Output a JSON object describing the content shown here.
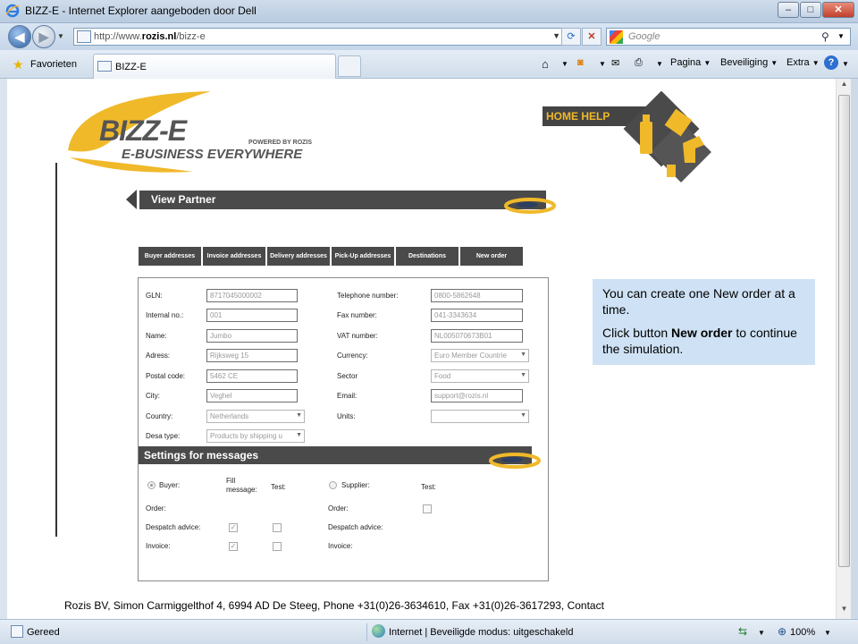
{
  "window": {
    "title": "BIZZ-E - Internet Explorer aangeboden door Dell",
    "min": "–",
    "max": "□",
    "close": "✕"
  },
  "nav": {
    "back": "◀",
    "forward": "▶",
    "url_prefix": "http://www.",
    "url_domain": "rozis.nl",
    "url_path": "/bizz-e",
    "search_placeholder": "Google"
  },
  "favbar": {
    "favorites_label": "Favorieten",
    "tab_label": "BIZZ-E",
    "commands": [
      "Pagina",
      "Beveiliging",
      "Extra"
    ]
  },
  "page": {
    "logo_brand": "BIZZ-E",
    "logo_tagline": "E-BUSINESS EVERYWHERE",
    "logo_powered": "POWERED BY ROZIS",
    "home_help": "HOME HELP",
    "section_title": "View Partner",
    "tabs": [
      "Buyer addresses",
      "Invoice addresses",
      "Delivery addresses",
      "Pick-Up addresses",
      "Destinations",
      "New order"
    ],
    "left_fields": [
      {
        "label": "GLN:",
        "value": "8717045000002",
        "kind": "input"
      },
      {
        "label": "Internal no.:",
        "value": "001",
        "kind": "input"
      },
      {
        "label": "Name:",
        "value": "Jumbo",
        "kind": "input"
      },
      {
        "label": "Adress:",
        "value": "Rijksweg 15",
        "kind": "input"
      },
      {
        "label": "Postal code:",
        "value": "5462 CE",
        "kind": "input"
      },
      {
        "label": "City:",
        "value": "Veghel",
        "kind": "input"
      },
      {
        "label": "Country:",
        "value": "Netherlands",
        "kind": "select"
      },
      {
        "label": "Desa type:",
        "value": "Products by shipping u",
        "kind": "select"
      }
    ],
    "right_fields": [
      {
        "label": "Telephone number:",
        "value": "0800-5862648",
        "kind": "input"
      },
      {
        "label": "Fax number:",
        "value": "041-3343634",
        "kind": "input"
      },
      {
        "label": "VAT number:",
        "value": "NL005070673B01",
        "kind": "input"
      },
      {
        "label": "Currency:",
        "value": "Euro Member Countrie",
        "kind": "select"
      },
      {
        "label": "Sector",
        "value": "Food",
        "kind": "select"
      },
      {
        "label": "Email:",
        "value": "support@rozis.nl",
        "kind": "input"
      },
      {
        "label": "Units:",
        "value": "",
        "kind": "select"
      }
    ],
    "settings_title": "Settings for messages",
    "buyer_label": "Buyer:",
    "fill_message": "Fill\nmessage:",
    "test_label": "Test:",
    "supplier_label": "Supplier:",
    "rows_left": [
      "Order:",
      "Despatch advice:",
      "Invoice:"
    ],
    "rows_right": [
      "Order:",
      "Despatch advice:",
      "Invoice:"
    ],
    "check_mark": "✓"
  },
  "info": {
    "line1": "You can create one New order at a time.",
    "line2_pre": "Click button ",
    "line2_bold": "New order",
    "line2_post": " to continue the simulation."
  },
  "footer": "Rozis BV, Simon Carmiggelthof 4, 6994 AD De Steeg, Phone +31(0)26-3634610, Fax +31(0)26-3617293, Contact",
  "status": {
    "left": "Gereed",
    "zone": "Internet | Beveiligde modus: uitgeschakeld",
    "zoom": "100%"
  },
  "colors": {
    "brand_yellow": "#f0b92a",
    "dark_bar": "#4a4a4a",
    "info_bg": "#cfe2f5"
  }
}
